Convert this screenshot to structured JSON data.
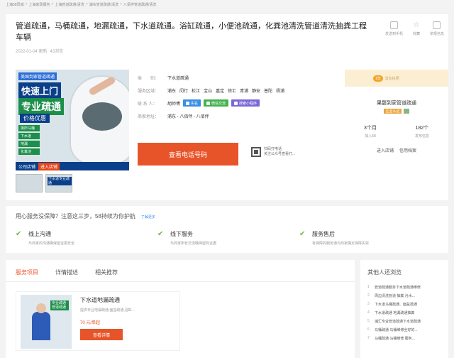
{
  "breadcrumb": [
    "上海58同城",
    "上海家政服务",
    "上海管道疏通/清洗",
    "浦东管道疏通/清洗",
    "八佰伴管道疏通/清洗"
  ],
  "listing": {
    "title": "管道疏通，马桶疏通，地漏疏通，下水道疏通。浴缸疏通，小便池疏通，化粪池清洗管道清洗抽粪工程车辆",
    "date": "2022-01-04 更新",
    "views": "43浏览",
    "tools": [
      "发送到手机",
      "收藏",
      "举报信息"
    ]
  },
  "gallery": {
    "hero_tag1": "美国到家管道疏通",
    "hero_tag2": "快速上门",
    "hero_tag3": "专业疏通",
    "hero_tag4": "价格优惠",
    "hero_points": [
      "厕所马桶",
      "下水道",
      "地漏",
      "化粪池"
    ],
    "hero_footer": "公司店铺",
    "hero_footer_btn": "进入店铺",
    "thumb1": "",
    "thumb2": "下水道专业疏通"
  },
  "info": {
    "category_label": "类　　别：",
    "category_value": "下水道疏通",
    "area_label": "服务区域：",
    "areas": [
      "浦东",
      "闵行",
      "松江",
      "宝山",
      "嘉定",
      "徐汇",
      "青浦",
      "静安",
      "普陀",
      "杨浦"
    ],
    "contact_label": "联 系 人：",
    "contact_value": "胡师傅",
    "chip_verified": "实名",
    "chip_wechat": "微信交流",
    "chip_miniapp": "搜索小程序",
    "address_label": "商家地址：",
    "address_value": "浦东 - 八佰伴 - 八佰伴",
    "call_button": "查看电话号码",
    "qr_line1": "扫码打电话",
    "qr_line2": "关注公众号查看打..."
  },
  "shop": {
    "badge": "1年",
    "badge_text": "营业执照",
    "name": "果馥到家管道疏通",
    "flag": "企业认证",
    "stat1_value": "3个月",
    "stat1_label": "加入58",
    "stat2_value": "182个",
    "stat2_label": "发布信息",
    "link1": "进入店铺",
    "link2": "信用档案"
  },
  "guarantee": {
    "heading": "用心服务没保障？注意这三步，58持续为你护航",
    "more": "了解更多",
    "items": [
      {
        "title": "线上沟通",
        "sub": "与商家的沟通确保留证更安全"
      },
      {
        "title": "线下服务",
        "sub": "与商家所有交流确保留有证据"
      },
      {
        "title": "服务售后",
        "sub": "有保障的服务通与商家确定保障实效"
      }
    ]
  },
  "service": {
    "tabs": [
      "服务项目",
      "详情描述",
      "相关推荐"
    ],
    "item_title": "下水道地漏疏通",
    "item_desc": "提供专业地漏疏通,面盆疏通,浴缸...",
    "item_price": "70 元/单起",
    "item_button": "查看详情",
    "item_pic_label": "专业疏通 管道疏通"
  },
  "others": {
    "heading": "其他人还浏览",
    "items": [
      "管道疏通服务下水道疏通维修",
      "周边清洗管道 抽粪 污水...",
      "下水道马桶疏通、面盆疏通",
      "下水道疏通 地漏疏通抽粪",
      "浦汇专业管道疏通下水道疏通",
      "马桶疏通 马桶维修全好的...",
      "马桶疏通 马桶维修 服务..."
    ]
  }
}
